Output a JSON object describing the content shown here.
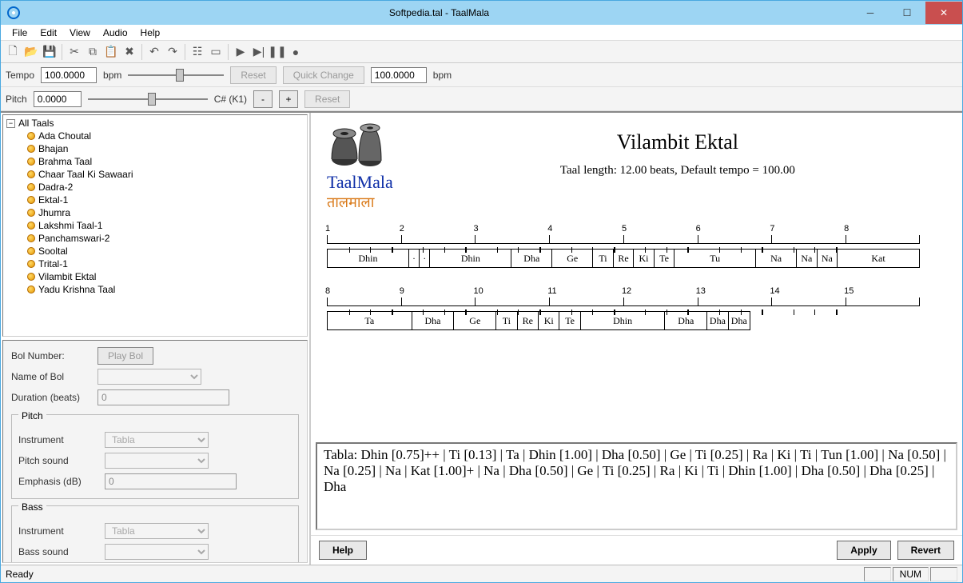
{
  "window": {
    "title": "Softpedia.tal - TaalMala"
  },
  "menu": {
    "file": "File",
    "edit": "Edit",
    "view": "View",
    "audio": "Audio",
    "help": "Help"
  },
  "tempo": {
    "label": "Tempo",
    "value": "100.0000",
    "unit": "bpm",
    "reset": "Reset",
    "quick": "Quick Change",
    "value2": "100.0000",
    "unit2": "bpm"
  },
  "pitch": {
    "label": "Pitch",
    "value": "0.0000",
    "note": "C# (K1)",
    "minus": "-",
    "plus": "+",
    "reset": "Reset"
  },
  "tree": {
    "root": "All Taals",
    "items": [
      "Ada Choutal",
      "Bhajan",
      "Brahma Taal",
      "Chaar Taal Ki Sawaari",
      "Dadra-2",
      "Ektal-1",
      "Jhumra",
      "Lakshmi Taal-1",
      "Panchamswari-2",
      "Sooltal",
      "Trital-1",
      "Vilambit Ektal",
      "Yadu Krishna Taal"
    ]
  },
  "props": {
    "bolnum_lbl": "Bol Number:",
    "playbol": "Play Bol",
    "name_lbl": "Name of Bol",
    "dur_lbl": "Duration (beats)",
    "dur_val": "0",
    "pitch_group": "Pitch",
    "instr_lbl": "Instrument",
    "instr_val": "Tabla",
    "psound_lbl": "Pitch sound",
    "emph_lbl": "Emphasis (dB)",
    "emph_val": "0",
    "bass_group": "Bass",
    "binstr_lbl": "Instrument",
    "binstr_val": "Tabla",
    "bsound_lbl": "Bass sound"
  },
  "brand": {
    "en": "TaalMala",
    "hi": "तालमाला"
  },
  "content": {
    "title": "Vilambit Ektal",
    "sub": "Taal length: 12.00 beats, Default tempo = 100.00",
    "ruler1": [
      "1",
      "2",
      "3",
      "4",
      "5",
      "6",
      "7",
      "8"
    ],
    "row1": [
      {
        "t": "Dhin",
        "w": 1.0
      },
      {
        "t": "·",
        "w": 0.13
      },
      {
        "t": "·",
        "w": 0.13
      },
      {
        "t": "Dhin",
        "w": 1.0
      },
      {
        "t": "Dha",
        "w": 0.5
      },
      {
        "t": "Ge",
        "w": 0.5
      },
      {
        "t": "Ti",
        "w": 0.25
      },
      {
        "t": "Re",
        "w": 0.25
      },
      {
        "t": "Ki",
        "w": 0.25
      },
      {
        "t": "Te",
        "w": 0.25
      },
      {
        "t": "Tu",
        "w": 1.0
      },
      {
        "t": "Na",
        "w": 0.5
      },
      {
        "t": "Na",
        "w": 0.25
      },
      {
        "t": "Na",
        "w": 0.25
      },
      {
        "t": "Kat",
        "w": 1.0
      }
    ],
    "ruler2": [
      "8",
      "9",
      "10",
      "11",
      "12",
      "13",
      "14",
      "15"
    ],
    "row2": [
      {
        "t": "Ta",
        "w": 1.0
      },
      {
        "t": "Dha",
        "w": 0.5
      },
      {
        "t": "Ge",
        "w": 0.5
      },
      {
        "t": "Ti",
        "w": 0.25
      },
      {
        "t": "Re",
        "w": 0.25
      },
      {
        "t": "Ki",
        "w": 0.25
      },
      {
        "t": "Te",
        "w": 0.25
      },
      {
        "t": "Dhin",
        "w": 1.0
      },
      {
        "t": "Dha",
        "w": 0.5
      },
      {
        "t": "Dha",
        "w": 0.25
      },
      {
        "t": "Dha",
        "w": 0.25
      }
    ],
    "textout": "Tabla: Dhin [0.75]++ | Ti [0.13] | Ta | Dhin [1.00] | Dha [0.50] | Ge | Ti [0.25] | Ra | Ki | Ti | Tun [1.00] | Na [0.50] | Na [0.25] | Na | Kat [1.00]+ | Na | Dha [0.50] | Ge | Ti [0.25] | Ra | Ki | Ti | Dhin [1.00] | Dha [0.50] | Dha [0.25] | Dha"
  },
  "buttons": {
    "help": "Help",
    "apply": "Apply",
    "revert": "Revert"
  },
  "status": {
    "ready": "Ready",
    "num": "NUM"
  }
}
